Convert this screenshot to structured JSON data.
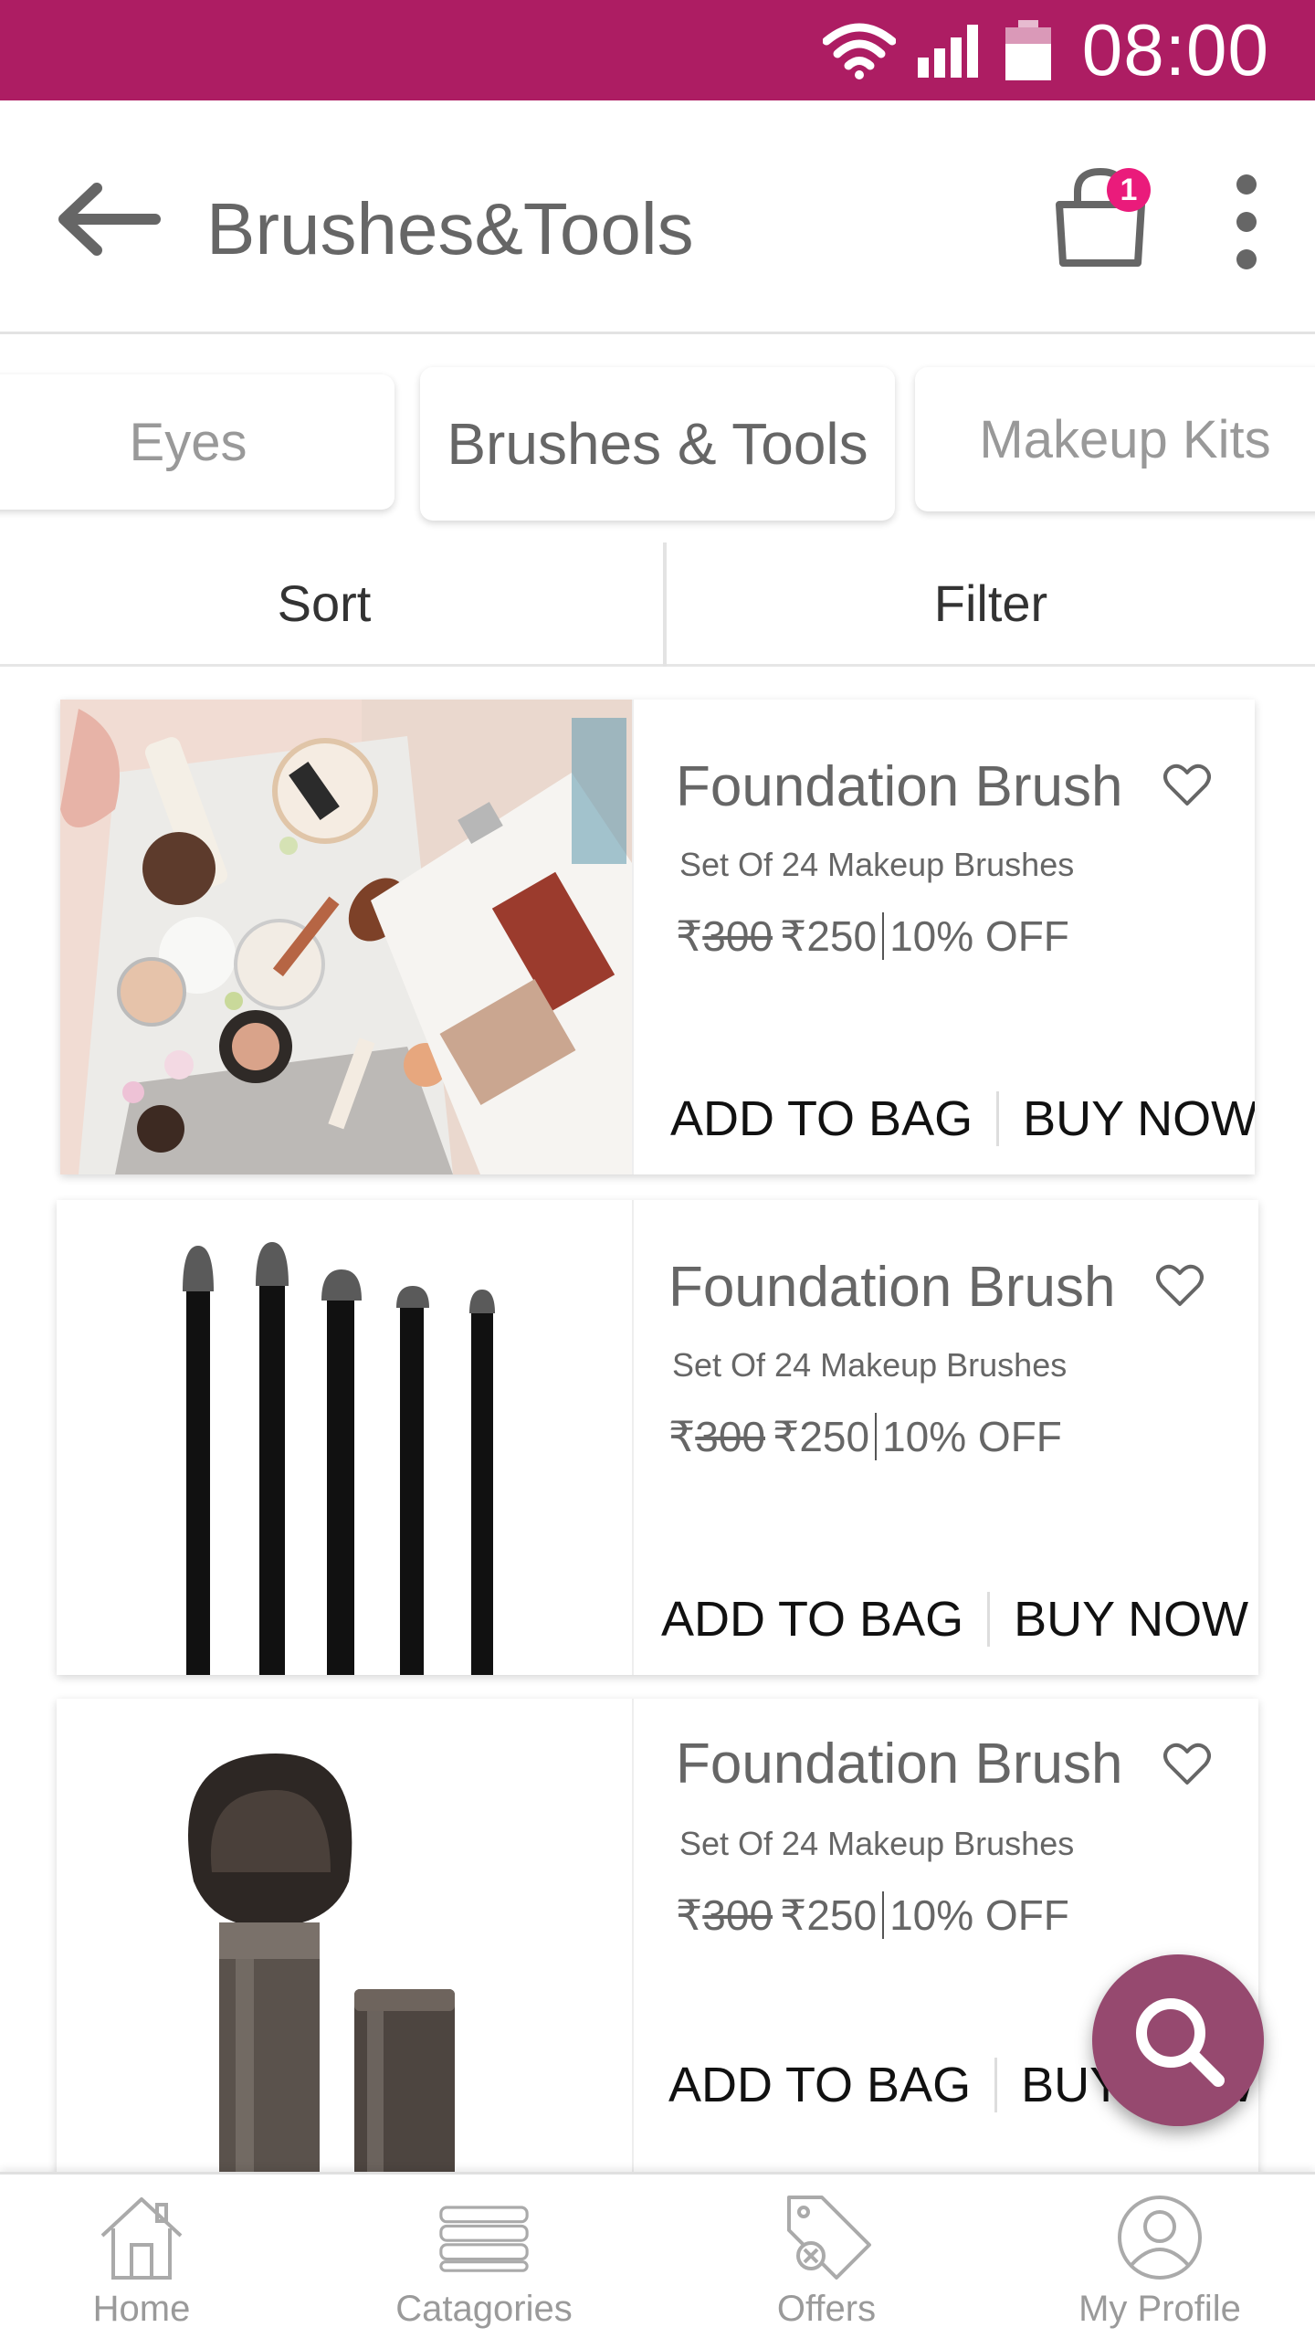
{
  "status_bar": {
    "time": "08:00",
    "icons": [
      "wifi-icon",
      "signal-icon",
      "battery-icon"
    ]
  },
  "header": {
    "title": "Brushes&Tools",
    "cart_count": "1",
    "icons": [
      "back-arrow-icon",
      "shopping-bag-icon",
      "more-vert-icon"
    ]
  },
  "tabs": [
    {
      "label": "Eyes"
    },
    {
      "label": "Brushes & Tools"
    },
    {
      "label": "Makeup Kits"
    }
  ],
  "toolbar": {
    "sort_label": "Sort",
    "filter_label": "Filter"
  },
  "products": [
    {
      "name": "Foundation Brush",
      "description": "Set Of 24 Makeup Brushes",
      "currency": "₹",
      "old_price": "300",
      "new_price": "250",
      "discount": "10% OFF",
      "add_label": "ADD TO BAG",
      "buy_label": "BUY NOW"
    },
    {
      "name": "Foundation Brush",
      "description": "Set Of 24 Makeup Brushes",
      "currency": "₹",
      "old_price": "300",
      "new_price": "250",
      "discount": "10% OFF",
      "add_label": "ADD TO BAG",
      "buy_label": "BUY NOW"
    },
    {
      "name": "Foundation Brush",
      "description": "Set Of 24 Makeup Brushes",
      "currency": "₹",
      "old_price": "300",
      "new_price": "250",
      "discount": "10% OFF",
      "add_label": "ADD TO BAG",
      "buy_label": "BUY NOW"
    }
  ],
  "bottom_nav": [
    {
      "label": "Home",
      "icon": "home-icon"
    },
    {
      "label": "Catagories",
      "icon": "categories-icon"
    },
    {
      "label": "Offers",
      "icon": "offers-tag-icon"
    },
    {
      "label": "My Profile",
      "icon": "profile-icon"
    }
  ],
  "colors": {
    "brand": "#ad1d63",
    "badge": "#ea1b7b",
    "fab": "#96496f"
  }
}
